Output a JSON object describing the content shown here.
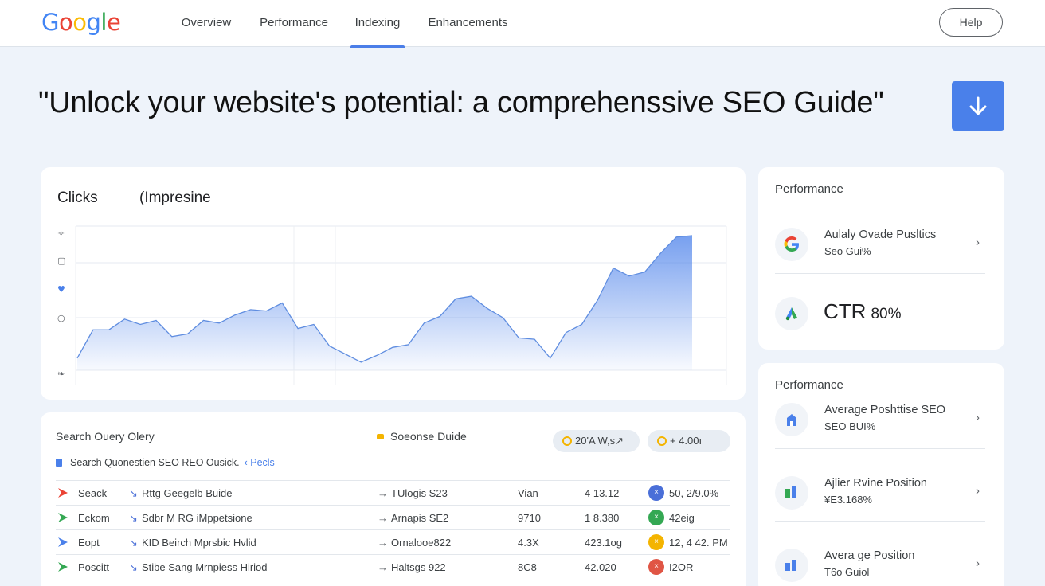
{
  "header": {
    "logo_letters": [
      {
        "ch": "G",
        "color": "#4285f4"
      },
      {
        "ch": "o",
        "color": "#ea4335"
      },
      {
        "ch": "o",
        "color": "#fbbc05"
      },
      {
        "ch": "g",
        "color": "#4285f4"
      },
      {
        "ch": "l",
        "color": "#34a853"
      },
      {
        "ch": "e",
        "color": "#ea4335"
      }
    ],
    "tabs": [
      {
        "label": "Overview"
      },
      {
        "label": "Performance"
      },
      {
        "label": "Indexing",
        "active": true
      },
      {
        "label": "Enhancements"
      }
    ],
    "help_label": "Help"
  },
  "hero": {
    "title": "\"Unlock your website's potential: a comprehenssive SEO Guide\"",
    "download_icon": "arrow-down-icon"
  },
  "chart_card": {
    "tabs": [
      "Clicks",
      "(Impresine"
    ],
    "side_icons": [
      "sparkle-icon",
      "comment-icon",
      "heart-icon",
      "shield-icon",
      "leaf-icon"
    ]
  },
  "chart_data": {
    "type": "area",
    "title": "",
    "xlabel": "",
    "ylabel": "",
    "grid": true,
    "series": [
      {
        "name": "Clicks",
        "values": [
          9,
          30,
          30,
          38,
          34,
          37,
          25,
          27,
          37,
          35,
          41,
          45,
          44,
          50,
          31,
          34,
          18,
          12,
          6,
          11,
          17,
          19,
          35,
          40,
          53,
          55,
          46,
          39,
          24,
          23,
          9,
          28,
          34,
          52,
          76,
          70,
          73,
          87,
          99,
          100
        ]
      }
    ],
    "color": "#4a80ea"
  },
  "table_card": {
    "title": "Search Ouery Olery",
    "mid_label": "Soeonse Duide",
    "pills": [
      "20'A W,s↗",
      "+ 4.00ı"
    ],
    "subtitle": "Search Quonestien SEO REO Ousick.",
    "subtitle_link": "Pecls",
    "rows": [
      {
        "name": "Seack",
        "query": "Rttg Geegelb Buide",
        "page": "TUlogis S23",
        "col4": "Vian",
        "col5": "4 13.12",
        "badge_color": "#4a6fd8",
        "badge_glyph": "×",
        "value": "50, 2/9.0%",
        "icon_color": "#ea4335"
      },
      {
        "name": "Eckom",
        "query": "Sdbr M RG iMppetsione",
        "page": "Arnapis SE2",
        "col4": "9710",
        "col5": "1 8.380",
        "badge_color": "#34a853",
        "badge_glyph": "×",
        "value": "42eig",
        "icon_color": "#34a853"
      },
      {
        "name": "Eopt",
        "query": "KID Beirch Mprsbic Hvlid",
        "page": "Ornalooe822",
        "col4": "4.3X",
        "col5": "423.1og",
        "badge_color": "#f4b400",
        "badge_glyph": "×",
        "value": "12, 4 42. PM",
        "icon_color": "#4a80ea"
      },
      {
        "name": "Poscitt",
        "query": "Stibe Sang Mrnpiess Hiriod",
        "page": "Haltsgs 922",
        "col4": "8C8",
        "col5": "42.020",
        "badge_color": "#e05545",
        "badge_glyph": "×",
        "value": "I2OR",
        "icon_color": "#34a853"
      }
    ]
  },
  "side_card_1": {
    "title": "Performance",
    "item": {
      "line1": "Aulaly Ovade Pusltics",
      "line2": "Seo Gui%",
      "icon": "google-g-icon"
    },
    "ctr_label": "CTR",
    "ctr_value": "80%",
    "ctr_icon": "ads-triangle-icon"
  },
  "side_card_2": {
    "title": "Performance",
    "items": [
      {
        "line1": "Average Poshttise SEO",
        "line2": "SEO BUI%",
        "icon": "building-icon"
      },
      {
        "line1": "Ajlier Rvine Position",
        "line2": "¥E3.168%",
        "icon": "bar-chart-icon"
      },
      {
        "line1": "Avera ge Position",
        "line2": "T6o  Guiol",
        "icon": "bar-chart-icon"
      }
    ]
  }
}
